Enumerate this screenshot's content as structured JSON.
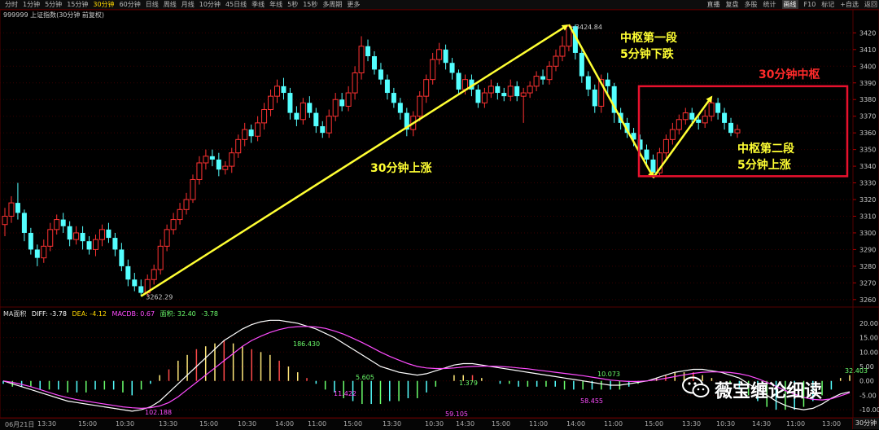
{
  "toolbar": {
    "periods": [
      "分时",
      "1分钟",
      "5分钟",
      "15分钟",
      "30分钟",
      "60分钟",
      "日线",
      "周线",
      "月线",
      "10分钟",
      "45日线",
      "季线",
      "年线",
      "5秒",
      "15秒",
      "多周期",
      "更多"
    ],
    "active_period": "30分钟",
    "right_buttons": [
      "直播",
      "复盘",
      "多股",
      "统计",
      "画线",
      "F10",
      "标记",
      "+自选",
      "返回"
    ],
    "active_right": "画线"
  },
  "symbol_label": "999999 上证指数(30分钟 前复权)",
  "colors": {
    "up": "#ff3232",
    "down": "#54ffff",
    "annotation_line": "#ffff33",
    "box": "#e8112d"
  },
  "chart_data": {
    "type": "candlestick",
    "price_axis": {
      "ticks": [
        3260,
        3270,
        3280,
        3290,
        3300,
        3310,
        3320,
        3330,
        3340,
        3350,
        3360,
        3370,
        3380,
        3390,
        3400,
        3410,
        3420
      ],
      "range": [
        3256,
        3428
      ]
    },
    "macd_axis": {
      "ticks": [
        -10.0,
        -5.0,
        0.0,
        5.0,
        10.0,
        15.0,
        20.0
      ],
      "range": [
        -12.5,
        22.5
      ]
    },
    "high_label": "3424.84",
    "low_label": "3262.29",
    "candles": [
      [
        3305,
        3310,
        3315,
        3298
      ],
      [
        3310,
        3318,
        3322,
        3306
      ],
      [
        3318,
        3312,
        3330,
        3308
      ],
      [
        3312,
        3300,
        3314,
        3295
      ],
      [
        3300,
        3290,
        3303,
        3287
      ],
      [
        3290,
        3285,
        3293,
        3280
      ],
      [
        3285,
        3292,
        3296,
        3282
      ],
      [
        3292,
        3302,
        3306,
        3289
      ],
      [
        3302,
        3308,
        3311,
        3299
      ],
      [
        3308,
        3304,
        3312,
        3300
      ],
      [
        3304,
        3296,
        3307,
        3292
      ],
      [
        3296,
        3300,
        3304,
        3293
      ],
      [
        3300,
        3295,
        3304,
        3290
      ],
      [
        3295,
        3290,
        3298,
        3287
      ],
      [
        3290,
        3296,
        3299,
        3286
      ],
      [
        3296,
        3302,
        3305,
        3292
      ],
      [
        3302,
        3297,
        3306,
        3294
      ],
      [
        3297,
        3290,
        3300,
        3286
      ],
      [
        3290,
        3280,
        3294,
        3277
      ],
      [
        3280,
        3272,
        3284,
        3268
      ],
      [
        3272,
        3268,
        3276,
        3265
      ],
      [
        3268,
        3264,
        3272,
        3262
      ],
      [
        3264,
        3272,
        3275,
        3262
      ],
      [
        3272,
        3278,
        3281,
        3269
      ],
      [
        3278,
        3292,
        3296,
        3275
      ],
      [
        3292,
        3302,
        3305,
        3289
      ],
      [
        3302,
        3308,
        3312,
        3299
      ],
      [
        3308,
        3314,
        3318,
        3305
      ],
      [
        3314,
        3320,
        3324,
        3311
      ],
      [
        3320,
        3332,
        3335,
        3318
      ],
      [
        3332,
        3342,
        3346,
        3329
      ],
      [
        3342,
        3346,
        3350,
        3338
      ],
      [
        3346,
        3344,
        3350,
        3340
      ],
      [
        3344,
        3338,
        3348,
        3334
      ],
      [
        3338,
        3340,
        3343,
        3335
      ],
      [
        3340,
        3348,
        3351,
        3336
      ],
      [
        3348,
        3356,
        3359,
        3345
      ],
      [
        3356,
        3362,
        3366,
        3352
      ],
      [
        3362,
        3358,
        3365,
        3354
      ],
      [
        3358,
        3366,
        3370,
        3355
      ],
      [
        3366,
        3374,
        3378,
        3362
      ],
      [
        3374,
        3382,
        3386,
        3370
      ],
      [
        3382,
        3388,
        3392,
        3378
      ],
      [
        3388,
        3384,
        3393,
        3380
      ],
      [
        3384,
        3372,
        3387,
        3368
      ],
      [
        3372,
        3368,
        3376,
        3364
      ],
      [
        3368,
        3378,
        3381,
        3365
      ],
      [
        3378,
        3372,
        3382,
        3369
      ],
      [
        3372,
        3364,
        3375,
        3360
      ],
      [
        3364,
        3360,
        3367,
        3357
      ],
      [
        3360,
        3370,
        3374,
        3357
      ],
      [
        3370,
        3380,
        3384,
        3367
      ],
      [
        3380,
        3376,
        3384,
        3373
      ],
      [
        3376,
        3384,
        3388,
        3373
      ],
      [
        3384,
        3396,
        3400,
        3380
      ],
      [
        3396,
        3412,
        3418,
        3392
      ],
      [
        3412,
        3406,
        3416,
        3403
      ],
      [
        3406,
        3398,
        3409,
        3395
      ],
      [
        3398,
        3392,
        3402,
        3389
      ],
      [
        3392,
        3384,
        3395,
        3380
      ],
      [
        3384,
        3378,
        3387,
        3375
      ],
      [
        3378,
        3372,
        3381,
        3368
      ],
      [
        3372,
        3362,
        3375,
        3358
      ],
      [
        3362,
        3370,
        3373,
        3358
      ],
      [
        3370,
        3382,
        3385,
        3367
      ],
      [
        3382,
        3392,
        3395,
        3378
      ],
      [
        3392,
        3404,
        3408,
        3389
      ],
      [
        3404,
        3410,
        3414,
        3401
      ],
      [
        3410,
        3402,
        3413,
        3398
      ],
      [
        3402,
        3396,
        3405,
        3392
      ],
      [
        3396,
        3386,
        3398,
        3383
      ],
      [
        3386,
        3392,
        3395,
        3383
      ],
      [
        3392,
        3386,
        3395,
        3382
      ],
      [
        3386,
        3378,
        3389,
        3375
      ],
      [
        3378,
        3384,
        3387,
        3375
      ],
      [
        3384,
        3388,
        3392,
        3381
      ],
      [
        3388,
        3384,
        3390,
        3380
      ],
      [
        3384,
        3382,
        3387,
        3379
      ],
      [
        3382,
        3388,
        3392,
        3379
      ],
      [
        3388,
        3382,
        3391,
        3379
      ],
      [
        3382,
        3384,
        3387,
        3366
      ],
      [
        3384,
        3388,
        3391,
        3381
      ],
      [
        3388,
        3394,
        3397,
        3385
      ],
      [
        3394,
        3392,
        3398,
        3389
      ],
      [
        3392,
        3400,
        3403,
        3389
      ],
      [
        3400,
        3406,
        3410,
        3397
      ],
      [
        3406,
        3412,
        3418,
        3403
      ],
      [
        3412,
        3424,
        3425,
        3409
      ],
      [
        3424,
        3408,
        3425,
        3404
      ],
      [
        3408,
        3394,
        3411,
        3390
      ],
      [
        3394,
        3386,
        3397,
        3382
      ],
      [
        3386,
        3376,
        3389,
        3372
      ],
      [
        3376,
        3392,
        3395,
        3372
      ],
      [
        3392,
        3388,
        3396,
        3382
      ],
      [
        3388,
        3372,
        3390,
        3366
      ],
      [
        3372,
        3366,
        3375,
        3362
      ],
      [
        3366,
        3360,
        3369,
        3357
      ],
      [
        3360,
        3356,
        3363,
        3352
      ],
      [
        3356,
        3350,
        3359,
        3346
      ],
      [
        3350,
        3344,
        3353,
        3340
      ],
      [
        3344,
        3336,
        3347,
        3333
      ],
      [
        3336,
        3348,
        3351,
        3334
      ],
      [
        3348,
        3356,
        3359,
        3345
      ],
      [
        3356,
        3362,
        3366,
        3353
      ],
      [
        3362,
        3368,
        3371,
        3359
      ],
      [
        3368,
        3372,
        3375,
        3365
      ],
      [
        3372,
        3368,
        3375,
        3364
      ],
      [
        3368,
        3366,
        3371,
        3362
      ],
      [
        3366,
        3370,
        3374,
        3363
      ],
      [
        3370,
        3378,
        3382,
        3367
      ],
      [
        3378,
        3372,
        3381,
        3368
      ],
      [
        3372,
        3366,
        3375,
        3362
      ],
      [
        3366,
        3360,
        3369,
        3358
      ],
      [
        3360,
        3362,
        3365,
        3357
      ]
    ],
    "macd": {
      "legend": {
        "name": "MA面积",
        "diff": "DIFF: -3.78",
        "dea": "DEA: -4.12",
        "macd": "MACDB: 0.67",
        "area": "面积: 32.40",
        "extra": "-3.78"
      },
      "labels": [
        {
          "text": "186.430",
          "color": "#6cff6c"
        },
        {
          "text": "102.188",
          "color": "#ff4cff"
        },
        {
          "text": "11.422",
          "color": "#ff4cff"
        },
        {
          "text": "5.605",
          "color": "#6cff6c"
        },
        {
          "text": "1.379",
          "color": "#6cff6c"
        },
        {
          "text": "59.105",
          "color": "#ff4cff"
        },
        {
          "text": "10.073",
          "color": "#6cff6c"
        },
        {
          "text": "58.455",
          "color": "#ff4cff"
        },
        {
          "text": "32.403",
          "color": "#6cff6c"
        }
      ],
      "diff": [
        0,
        -1,
        -2,
        -3,
        -4,
        -5,
        -6,
        -7,
        -7.5,
        -8,
        -8.5,
        -9,
        -9.5,
        -10,
        -10.5,
        -10,
        -9,
        -7,
        -4,
        -1,
        2,
        5,
        8,
        11,
        14,
        16,
        18,
        19.5,
        20.5,
        21,
        21,
        20.5,
        20,
        19,
        18,
        16.5,
        15,
        13,
        11,
        9,
        7,
        5,
        4,
        3,
        2.5,
        2,
        2.5,
        3.5,
        4.5,
        5.5,
        6,
        6,
        5.5,
        5,
        4.5,
        4,
        3.5,
        3,
        2.5,
        2,
        1.5,
        1,
        0.5,
        0,
        -0.5,
        -1,
        -1.5,
        -1.5,
        -1,
        -0.5,
        0,
        1,
        2,
        3,
        3.5,
        4,
        4,
        3.5,
        3,
        2,
        1,
        -1,
        -3,
        -5,
        -7,
        -8.5,
        -9.5,
        -10,
        -9.5,
        -8,
        -6,
        -4.5,
        -3.78
      ],
      "dea": [
        0,
        -0.5,
        -1.2,
        -2,
        -3,
        -4,
        -5,
        -5.8,
        -6.5,
        -7,
        -7.5,
        -8,
        -8.5,
        -9,
        -9.3,
        -9.5,
        -9.3,
        -8.7,
        -7.5,
        -5.5,
        -3,
        -0.5,
        2,
        4.5,
        7,
        9.5,
        12,
        14,
        15.5,
        16.8,
        17.8,
        18.5,
        18.8,
        18.9,
        18.7,
        18.2,
        17.3,
        16.2,
        14.8,
        13.3,
        11.7,
        10,
        8.5,
        7.2,
        6,
        5,
        4.5,
        4.3,
        4.3,
        4.5,
        4.8,
        5,
        5.1,
        5.1,
        5,
        4.8,
        4.5,
        4.2,
        3.8,
        3.4,
        3,
        2.6,
        2.2,
        1.8,
        1.3,
        0.8,
        0.3,
        0,
        -0.2,
        -0.2,
        0,
        0.4,
        0.9,
        1.5,
        2.1,
        2.6,
        3,
        3.1,
        3.1,
        2.9,
        2.5,
        1.8,
        0.8,
        -0.5,
        -1.9,
        -3.3,
        -4.6,
        -5.7,
        -6.4,
        -6.6,
        -6.2,
        -5.2,
        -4.12
      ],
      "bars": [
        -1,
        -2,
        -2,
        -2,
        -3,
        -3,
        -3,
        -4,
        -4,
        -4,
        -3,
        -3,
        -3,
        -4,
        -5,
        -3,
        -1,
        2,
        4,
        7,
        9,
        11,
        12,
        13,
        14,
        13,
        12,
        11,
        10,
        9,
        7,
        5,
        3,
        1,
        -1,
        -3,
        -4,
        -6,
        -7,
        -8,
        -8,
        -8,
        -7,
        -7,
        -6,
        -6,
        -4,
        -2,
        0,
        2,
        2,
        2,
        1,
        0,
        -1,
        -1,
        -2,
        -2,
        -2,
        -2,
        -2,
        -3,
        -3,
        -3,
        -3,
        -3,
        -3,
        -3,
        -2,
        -1,
        0,
        1,
        2,
        3,
        3,
        3,
        2,
        1,
        0,
        -1,
        -3,
        -5,
        -7,
        -9,
        -10,
        -10,
        -10,
        -9,
        -7,
        -5,
        -3,
        1,
        2
      ]
    }
  },
  "annotations": {
    "rise_label": "30分钟上涨",
    "seg1_line1": "中枢第一段",
    "seg1_line2": "5分钟下跌",
    "seg2_line1": "中枢第二段",
    "seg2_line2": "5分钟上涨",
    "center_label": "30分钟中枢"
  },
  "date_axis": [
    "06月21日",
    "13:30",
    "15:00",
    "10:30",
    "13:30",
    "15:00",
    "10:30",
    "14:00",
    "11:00",
    "15:00",
    "13:30",
    "10:30",
    "14:30",
    "15:00",
    "11:00",
    "14:00",
    "11:00",
    "15:00",
    "13:30",
    "10:30",
    "14:30",
    "11:00",
    "13:00"
  ],
  "period_tag": "30分钟",
  "watermark": "薇宝缠论细读"
}
